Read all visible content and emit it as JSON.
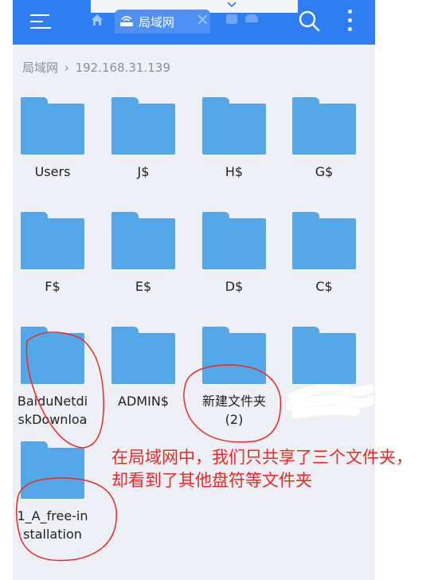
{
  "tab": {
    "label": "局域网"
  },
  "breadcrumb": {
    "root": "局域网",
    "separator": "›",
    "current": "192.168.31.139"
  },
  "folders": [
    "Users",
    "J$",
    "H$",
    "G$",
    "F$",
    "E$",
    "D$",
    "C$",
    "BaiduNetdiskDownloa",
    "ADMIN$",
    "新建文件夹 (2)",
    "",
    "1_A_free-installation"
  ],
  "annotation": {
    "text": "在局域网中，我们只共享了三个文件夹，却看到了其他盘符等文件夹"
  },
  "colors": {
    "toolbar": "#2f7df2",
    "folder": "#54a7e9",
    "annotation": "#ec2a24",
    "background": "#eef0f5"
  }
}
